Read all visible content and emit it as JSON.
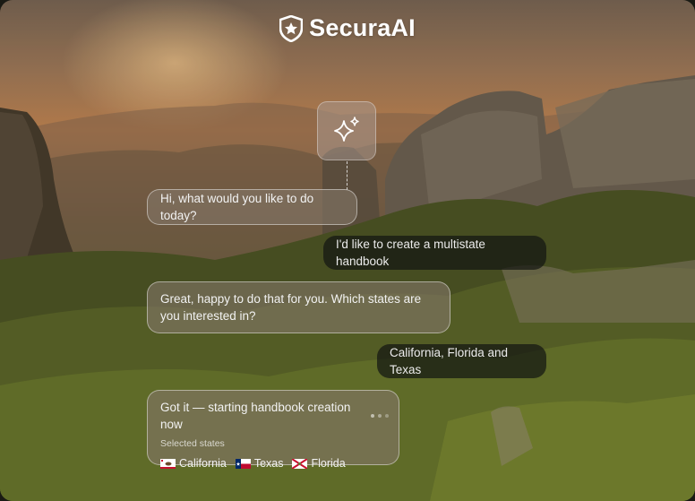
{
  "brand": {
    "name": "SecuraAI",
    "logo_icon": "shield-star-icon"
  },
  "assistant_icon": "sparkles-icon",
  "conversation": [
    {
      "role": "assistant",
      "text": "Hi, what would you like to do today?"
    },
    {
      "role": "user",
      "text": "I'd like to create a multistate handbook"
    },
    {
      "role": "assistant",
      "text": "Great, happy to do that for you. Which states are you interested in?"
    },
    {
      "role": "user",
      "text": "California, Florida and Texas"
    },
    {
      "role": "assistant",
      "text": "Got it — starting handbook creation now",
      "status": "in-progress",
      "selected_label": "Selected states",
      "states": [
        {
          "name": "California",
          "flag": "california-flag-icon"
        },
        {
          "name": "Texas",
          "flag": "texas-flag-icon"
        },
        {
          "name": "Florida",
          "flag": "florida-flag-icon"
        }
      ]
    }
  ],
  "colors": {
    "assistant_bubble": "#82766880",
    "user_bubble": "#141612b8",
    "text": "#f2f2f2"
  }
}
